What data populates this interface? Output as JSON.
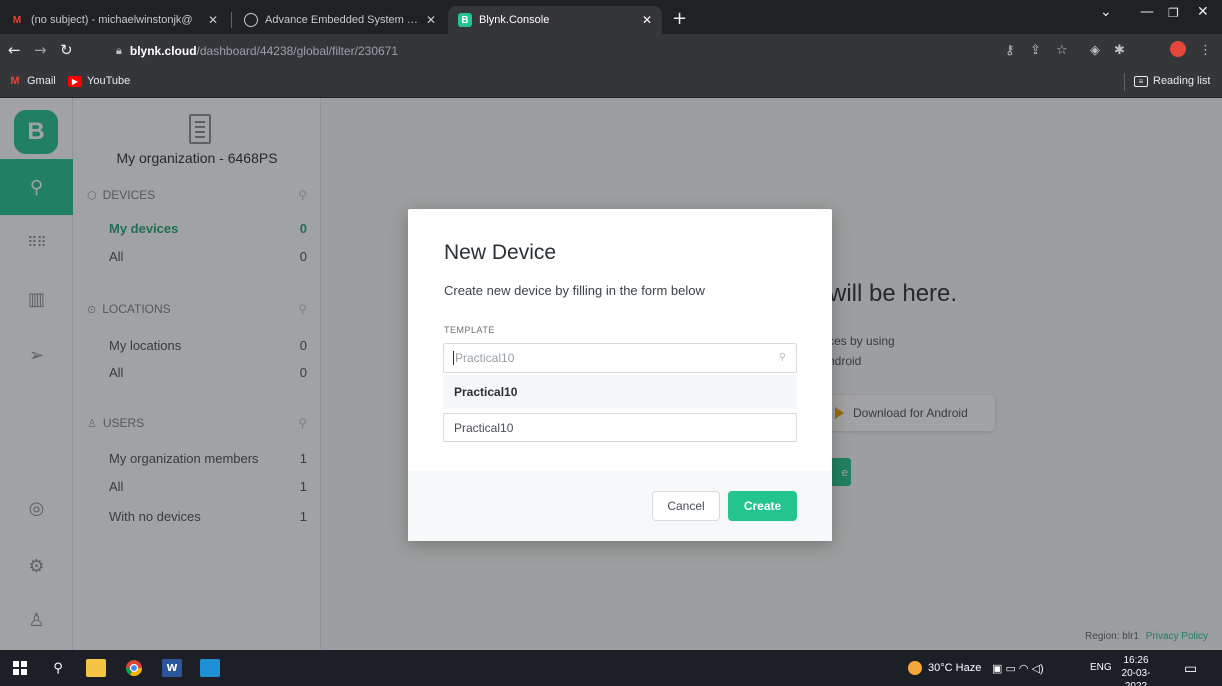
{
  "browser": {
    "tabs": [
      {
        "label": "(no subject) - michaelwinstonjk@",
        "favicon": "gmail-icon"
      },
      {
        "label": "Advance Embedded System Prac",
        "favicon": "globe-icon"
      },
      {
        "label": "Blynk.Console",
        "favicon": "blynk-icon",
        "favicon_letter": "B",
        "active": true
      }
    ],
    "new_tab": "+",
    "address": {
      "host": "blynk.cloud",
      "path": "/dashboard/44238/global/filter/230671"
    },
    "bookmarks": [
      {
        "label": "Gmail",
        "icon": "gmail-icon"
      },
      {
        "label": "YouTube",
        "icon": "youtube-icon"
      }
    ],
    "reading_list": "Reading list"
  },
  "app": {
    "logo_letter": "B",
    "organization": "My organization - 6468PS",
    "sections": {
      "devices": {
        "title": "DEVICES",
        "items": [
          {
            "label": "My devices",
            "count": "0"
          },
          {
            "label": "All",
            "count": "0"
          }
        ]
      },
      "locations": {
        "title": "LOCATIONS",
        "items": [
          {
            "label": "My locations",
            "count": "0"
          },
          {
            "label": "All",
            "count": "0"
          }
        ]
      },
      "users": {
        "title": "USERS",
        "items": [
          {
            "label": "My organization members",
            "count": "1"
          },
          {
            "label": "All",
            "count": "1"
          },
          {
            "label": "With no devices",
            "count": "1"
          }
        ]
      }
    },
    "background": {
      "headline": "will be here.",
      "line1": "ces by using",
      "line2": "ndroid",
      "android_button": "Download for Android",
      "green_button": "e"
    },
    "footer": {
      "region": "Region: blr1",
      "privacy": "Privacy Policy"
    }
  },
  "modal": {
    "title": "New Device",
    "subtitle": "Create new device by filling in the form below",
    "template_label": "TEMPLATE",
    "template_placeholder": "Practical10",
    "dropdown_option": "Practical10",
    "name_value": "Practical10",
    "cancel": "Cancel",
    "create": "Create"
  },
  "taskbar": {
    "weather": "30°C Haze",
    "language": "ENG",
    "time": "16:26",
    "date": "20-03-2022"
  },
  "colors": {
    "accent": "#23c48e",
    "chrome_dark": "#202124",
    "chrome_bar": "#35363a",
    "taskbar": "#1c1f26"
  }
}
